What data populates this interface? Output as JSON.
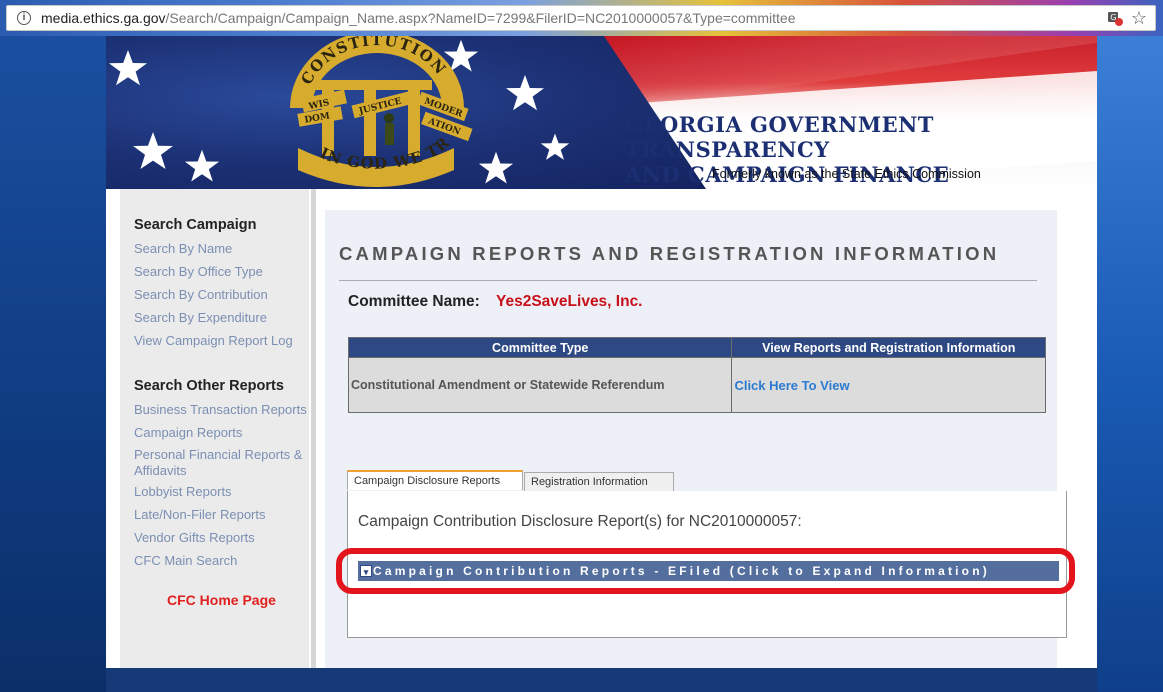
{
  "browser": {
    "url_host": "media.ethics.ga.gov",
    "url_path": "/Search/Campaign/Campaign_Name.aspx?NameID=7299&FilerID=NC2010000057&Type=committee",
    "info_icon": "info-icon",
    "bookmark_icon": "star-icon",
    "extension_icon": "translate-icon"
  },
  "banner": {
    "seal_top_text": "CONSTITUTION",
    "seal_bottom_text": "IN GOD WE TRUST",
    "seal_ribbons": [
      "WIS",
      "DOM",
      "JUSTICE",
      "MODER",
      "ATION"
    ],
    "title_line1": "GEORGIA GOVERNMENT TRANSPARENCY",
    "title_line2": "AND CAMPAIGN FINANCE COMMISSION",
    "subtitle": "Formerly known as the State Ethics Commission"
  },
  "sidebar": {
    "campaign_heading": "Search Campaign",
    "campaign_links": [
      "Search By Name",
      "Search By Office Type",
      "Search By Contribution",
      "Search By Expenditure",
      "View Campaign Report Log"
    ],
    "other_heading": "Search Other Reports",
    "other_links": [
      "Business Transaction Reports",
      "Campaign Reports",
      "Personal Financial Reports & Affidavits",
      "Lobbyist Reports",
      "Late/Non-Filer Reports",
      "Vendor Gifts Reports",
      "CFC Main Search"
    ],
    "home_link": "CFC Home Page"
  },
  "main": {
    "page_title": "CAMPAIGN REPORTS AND REGISTRATION INFORMATION",
    "committee_label": "Committee Name:",
    "committee_name": "Yes2SaveLives, Inc.",
    "table": {
      "headers": [
        "Committee Type",
        "View Reports and Registration Information"
      ],
      "rows": [
        [
          "Constitutional Amendment or Statewide Referendum",
          "Click Here To View"
        ]
      ]
    },
    "tabs": [
      {
        "label": "Campaign Disclosure Reports",
        "active": true
      },
      {
        "label": "Registration Information",
        "active": false
      }
    ],
    "disclosure_heading": "Campaign Contribution Disclosure Report(s) for NC2010000057:",
    "expand_bar_label": "Campaign Contribution Reports - EFiled (Click to Expand Information)",
    "expand_icon": "chevron-down-icon"
  },
  "colors": {
    "header_blue": "#2d4882",
    "link_blue": "#2b7bd0",
    "committee_red": "#c8101a",
    "highlight_red": "#e3141c",
    "sidebar_link": "#7b8fb3"
  }
}
